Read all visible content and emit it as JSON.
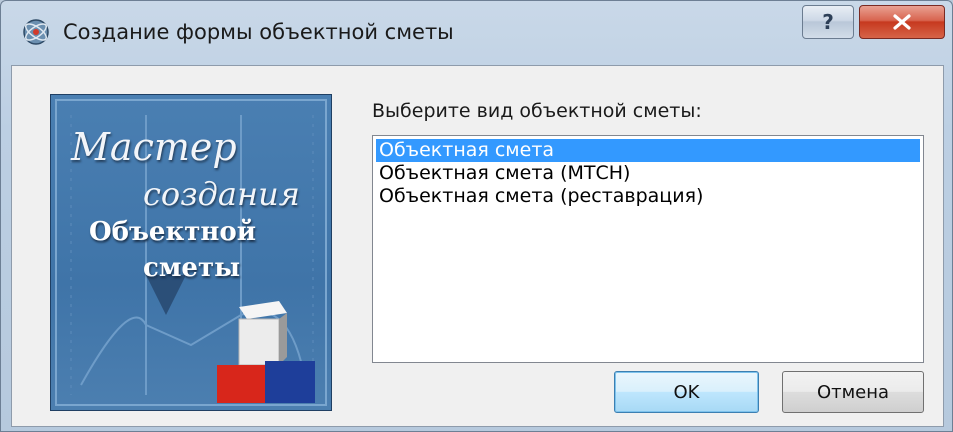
{
  "window": {
    "title": "Создание формы объектной сметы",
    "help_label": "?",
    "close_label": "X"
  },
  "banner": {
    "line1": "Мастер",
    "line2": "создания",
    "line3": "Объектной",
    "line4": "сметы"
  },
  "main": {
    "prompt": "Выберите вид объектной сметы:",
    "options": [
      {
        "label": "Объектная смета",
        "selected": true
      },
      {
        "label": "Объектная смета (МТСН)",
        "selected": false
      },
      {
        "label": "Объектная смета (реставрация)",
        "selected": false
      }
    ]
  },
  "buttons": {
    "ok": "OK",
    "cancel": "Отмена"
  },
  "colors": {
    "selection": "#3399ff",
    "banner_blue": "#3f74a8",
    "close_red": "#c6391f"
  }
}
